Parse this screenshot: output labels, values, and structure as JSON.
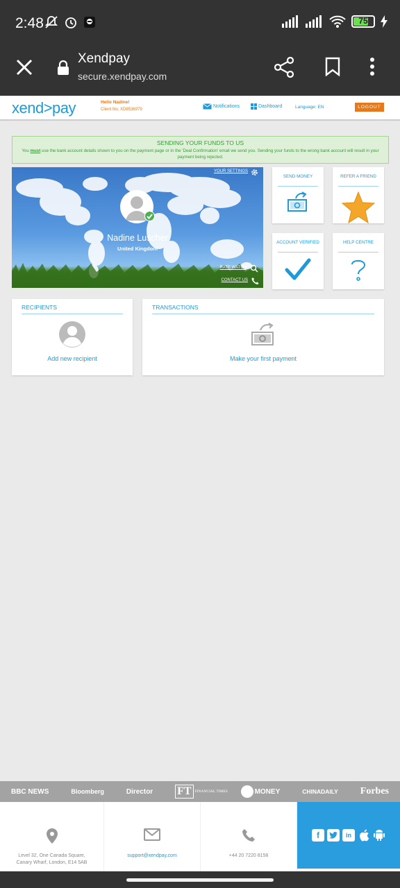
{
  "status_bar": {
    "time": "2:48",
    "battery": "75",
    "battery_level": 0.75,
    "icons": [
      "bell-off-icon",
      "alarm-icon",
      "app-icon",
      "signal-icon",
      "signal-icon",
      "wifi-icon",
      "battery-icon",
      "charging-icon"
    ]
  },
  "browser": {
    "title": "Xendpay",
    "url": "secure.xendpay.com"
  },
  "header": {
    "logo": "xend>pay",
    "hello": "Hello Nadine!",
    "client_no": "Client No. XD8536979",
    "notifications": "Notifications",
    "dashboard": "Dashboard",
    "language": "Language: EN",
    "logout": "LOGOUT"
  },
  "alert": {
    "heading": "SENDING YOUR FUNDS TO US",
    "must": "must",
    "body_before": "You ",
    "body_after": " use the bank account details shown to you on the payment page or in the 'Deal Confirmation' email we send you. Sending your funds to the wrong bank account will result in your payment being rejected."
  },
  "hero": {
    "settings": "YOUR SETTINGS",
    "name": "Nadine Luscher",
    "country": "United Kingdom",
    "rate_watch": "RATE WATCH",
    "contact": "CONTACT US"
  },
  "tiles": {
    "send_money": "SEND MONEY",
    "refer_friend": "REFER A FRIEND",
    "account_verified": "ACCOUNT VERIFIED",
    "help_centre": "HELP CENTRE"
  },
  "recipients": {
    "title": "RECIPIENTS",
    "link": "Add new recipient"
  },
  "transactions": {
    "title": "TRANSACTIONS",
    "link": "Make your first payment"
  },
  "press": {
    "bbc": "BBC NEWS",
    "bloomberg": "Bloomberg",
    "director": "Director",
    "ft": "FT",
    "ft_name": "FINANCIAL TIMES",
    "money": "MONEY",
    "chinadaily": "CHINADAILY",
    "forbes": "Forbes"
  },
  "footer": {
    "address": "Level 32, One Canada Square, Canary Wharf, London, E14 5AB",
    "email": "support@xendpay.com",
    "phone": "+44 20 7220 8158"
  },
  "colors": {
    "brand_blue": "#1e9ad6",
    "brand_orange": "#e37a1e",
    "alert_green": "#3c9a3c"
  }
}
